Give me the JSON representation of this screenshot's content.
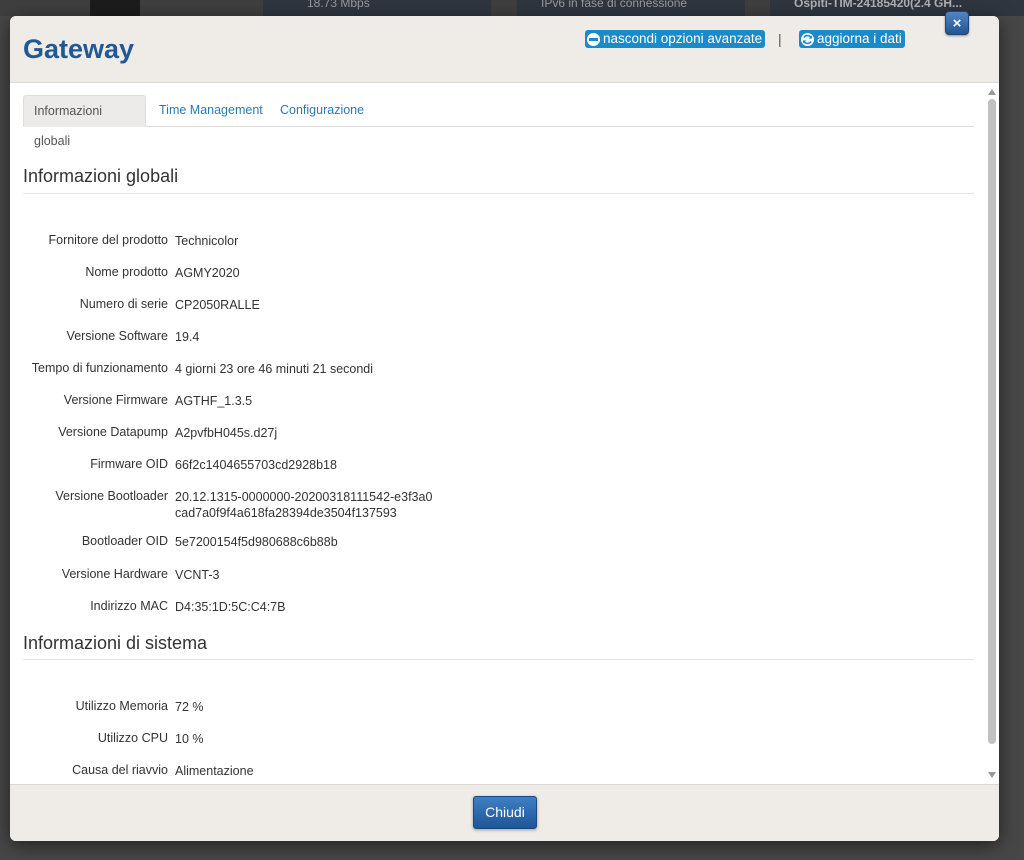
{
  "background": {
    "items": [
      "18.73 Mbps",
      "IPv6 in fase di connessione",
      "Ospiti-TIM-24185420(2.4 GH..."
    ]
  },
  "modal": {
    "title": "Gateway",
    "hide_advanced_label": "nascondi opzioni avanzate",
    "separator": "|",
    "refresh_label": "aggiorna i dati",
    "close_x": "×"
  },
  "tabs": [
    {
      "label": "Informazioni globali",
      "active": true
    },
    {
      "label": "Time Management",
      "active": false
    },
    {
      "label": "Configurazione",
      "active": false
    }
  ],
  "global_info": {
    "title": "Informazioni globali",
    "rows": [
      {
        "label": "Fornitore del prodotto",
        "value": "Technicolor"
      },
      {
        "label": "Nome prodotto",
        "value": "AGMY2020"
      },
      {
        "label": "Numero di serie",
        "value": "CP2050RALLE"
      },
      {
        "label": "Versione Software",
        "value": "19.4"
      },
      {
        "label": "Tempo di funzionamento",
        "value": "4 giorni 23 ore 46 minuti 21 secondi"
      },
      {
        "label": "Versione Firmware",
        "value": "AGTHF_1.3.5"
      },
      {
        "label": "Versione Datapump",
        "value": "A2pvfbH045s.d27j"
      },
      {
        "label": "Firmware OID",
        "value": "66f2c1404655703cd2928b18"
      },
      {
        "label": "Versione Bootloader",
        "value": "20.12.1315-0000000-20200318111542-e3f3a0cad7a0f9f4a618fa28394de3504f137593"
      },
      {
        "label": "Bootloader OID",
        "value": "5e7200154f5d980688c6b88b"
      },
      {
        "label": "Versione Hardware",
        "value": "VCNT-3"
      },
      {
        "label": "Indirizzo MAC",
        "value": "D4:35:1D:5C:C4:7B"
      }
    ]
  },
  "system_info": {
    "title": "Informazioni di sistema",
    "rows": [
      {
        "label": "Utilizzo Memoria",
        "value": "72 %"
      },
      {
        "label": "Utilizzo CPU",
        "value": "10 %"
      },
      {
        "label": "Causa del riavvio",
        "value": "Alimentazione"
      }
    ]
  },
  "footer": {
    "close_label": "Chiudi"
  },
  "colors": {
    "title": "#1f5a96",
    "header_button": "#1a8bc8",
    "tab_link": "#2a7bb0",
    "primary_button": "#1e5697"
  }
}
